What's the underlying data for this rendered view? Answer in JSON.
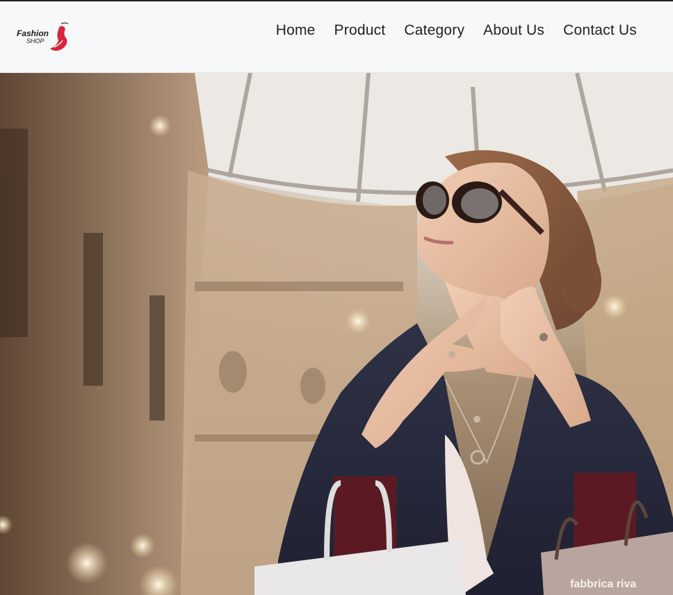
{
  "brand": {
    "logo_line1": "Fashion",
    "logo_line2": "SHOP"
  },
  "nav": {
    "items": [
      {
        "label": "Home"
      },
      {
        "label": "Product"
      },
      {
        "label": "Category"
      },
      {
        "label": "About Us"
      },
      {
        "label": "Contact Us"
      }
    ]
  },
  "hero": {
    "bag_text": "fabbrica riva"
  },
  "colors": {
    "navbar_bg": "#f7f8f9",
    "logo_red": "#d7263d",
    "nav_text": "#222222"
  }
}
